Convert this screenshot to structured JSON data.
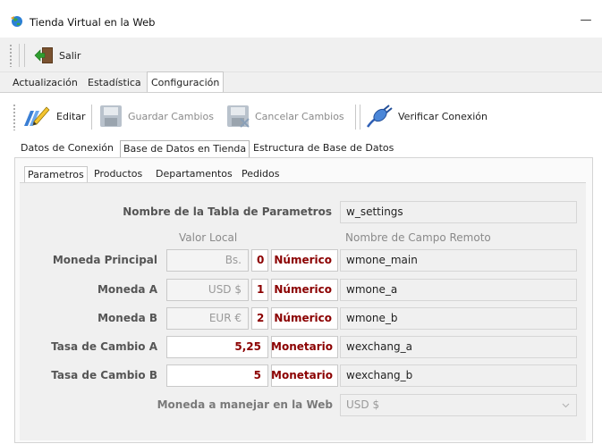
{
  "window": {
    "title": "Tienda Virtual en la Web",
    "minimize_glyph": "—"
  },
  "toolbar1": {
    "salir_label": "Salir",
    "salir_icon": "exit-door-arrow-icon"
  },
  "main_tabs": [
    {
      "label": "Actualización",
      "active": false
    },
    {
      "label": "Estadística",
      "active": false
    },
    {
      "label": "Configuración",
      "active": true
    }
  ],
  "toolbar2": {
    "editar": "Editar",
    "guardar": "Guardar Cambios",
    "cancelar": "Cancelar Cambios",
    "verificar": "Verificar Conexión"
  },
  "sub_tabs": [
    {
      "label": "Datos de Conexión",
      "active": false
    },
    {
      "label": "Base de Datos en Tienda",
      "active": true
    },
    {
      "label": "Estructura de Base de Datos",
      "active": false
    }
  ],
  "inner_tabs": [
    {
      "label": "Parametros",
      "active": true
    },
    {
      "label": "Productos",
      "active": false
    },
    {
      "label": "Departamentos",
      "active": false
    },
    {
      "label": "Pedidos",
      "active": false
    }
  ],
  "form": {
    "table_name_label": "Nombre de la Tabla de Parametros",
    "table_name_value": "w_settings",
    "header_local": "Valor Local",
    "header_remote": "Nombre de Campo Remoto",
    "rows": [
      {
        "label": "Moneda Principal",
        "local": "Bs.",
        "index": "0",
        "type": "Númerico",
        "remote": "wmone_main"
      },
      {
        "label": "Moneda A",
        "local": "USD $",
        "index": "1",
        "type": "Númerico",
        "remote": "wmone_a"
      },
      {
        "label": "Moneda B",
        "local": "EUR €",
        "index": "2",
        "type": "Númerico",
        "remote": "wmone_b"
      },
      {
        "label": "Tasa de Cambio A",
        "local": "5,25",
        "type": "Monetario",
        "remote": "wexchang_a"
      },
      {
        "label": "Tasa de Cambio B",
        "local": "5",
        "type": "Monetario",
        "remote": "wexchang_b"
      }
    ],
    "web_currency_label": "Moneda a manejar en la Web",
    "web_currency_value": "USD $"
  },
  "colors": {
    "accent_red": "#8b0000",
    "panel_bg": "#ffffff",
    "window_bg": "#f0f0f0"
  }
}
